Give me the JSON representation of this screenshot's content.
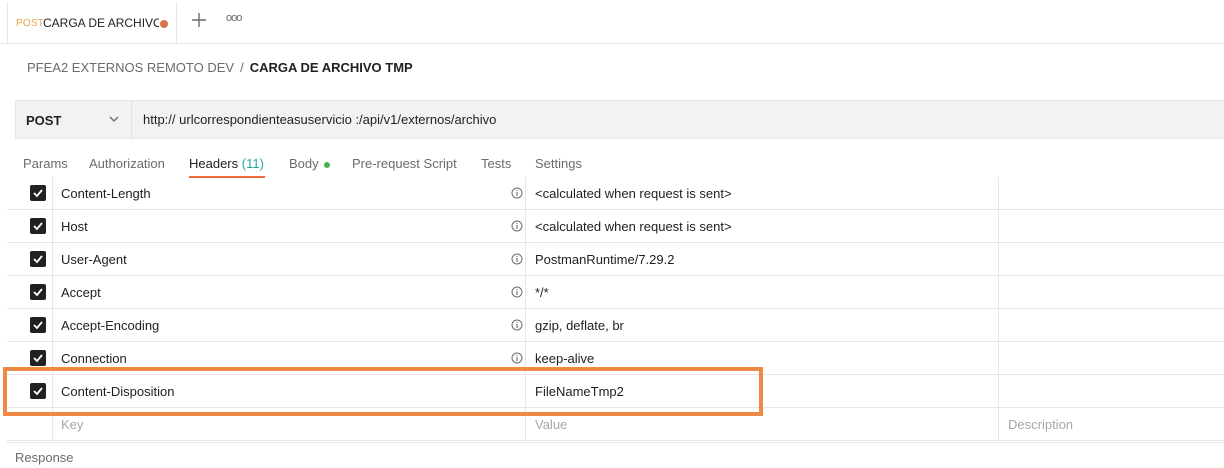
{
  "tab": {
    "method": "POST",
    "name": "CARGA DE ARCHIVO TMP",
    "unsaved_color": "#d9724c"
  },
  "breadcrumb": {
    "parent": "PFEA2 EXTERNOS REMOTO DEV",
    "separator": "/",
    "current": "CARGA DE ARCHIVO TMP"
  },
  "request": {
    "method": "POST",
    "url": "http:// urlcorrespondienteasuservicio :/api/v1/externos/archivo"
  },
  "request_tabs": {
    "params": "Params",
    "authorization": "Authorization",
    "headers": "Headers",
    "headers_count": "(11)",
    "body": "Body",
    "prerequest": "Pre-request Script",
    "tests": "Tests",
    "settings": "Settings"
  },
  "headers": [
    {
      "key": "Content-Length",
      "value": "<calculated when request is sent>",
      "checked": true
    },
    {
      "key": "Host",
      "value": "<calculated when request is sent>",
      "checked": true
    },
    {
      "key": "User-Agent",
      "value": "PostmanRuntime/7.29.2",
      "checked": true
    },
    {
      "key": "Accept",
      "value": "*/*",
      "checked": true
    },
    {
      "key": "Accept-Encoding",
      "value": "gzip, deflate, br",
      "checked": true
    },
    {
      "key": "Connection",
      "value": "keep-alive",
      "checked": true
    },
    {
      "key": "Content-Disposition",
      "value": "FileNameTmp2",
      "checked": true
    }
  ],
  "placeholders": {
    "key": "Key",
    "value": "Value",
    "description": "Description"
  },
  "response_label": "Response",
  "colors": {
    "accent": "#f26b3a",
    "highlight": "#ee8a44",
    "count": "#26a69a",
    "body_dot": "#4caf50"
  }
}
